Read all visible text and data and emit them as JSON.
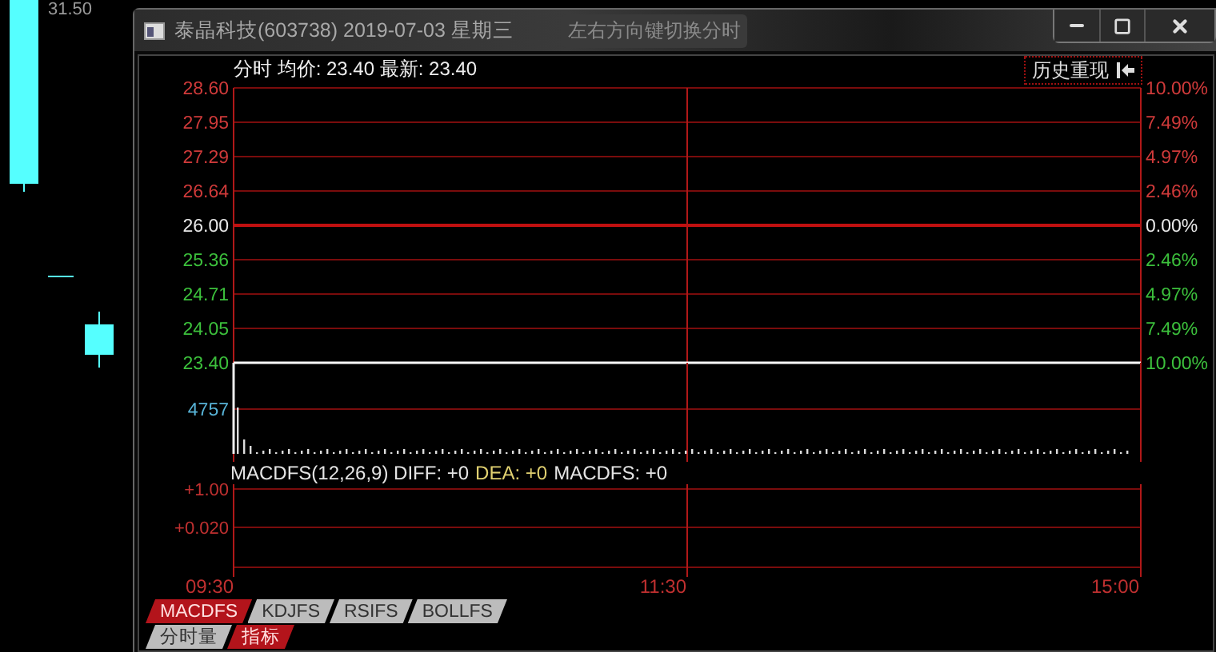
{
  "background_chart": {
    "price_label": "31.50"
  },
  "window": {
    "title": "泰晶科技(603738) 2019-07-03 星期三",
    "hint": "左右方向键切换分时"
  },
  "header": {
    "text": "分时 均价: 23.40 最新: 23.40",
    "history_button": "历史重现"
  },
  "price_panel": {
    "price_labels": [
      {
        "text": "28.60",
        "color": "#d03a3a"
      },
      {
        "text": "27.95",
        "color": "#d03a3a"
      },
      {
        "text": "27.29",
        "color": "#d03a3a"
      },
      {
        "text": "26.64",
        "color": "#d03a3a"
      },
      {
        "text": "26.00",
        "color": "#e8e8e8"
      },
      {
        "text": "25.36",
        "color": "#3cc03c"
      },
      {
        "text": "24.71",
        "color": "#3cc03c"
      },
      {
        "text": "24.05",
        "color": "#3cc03c"
      },
      {
        "text": "23.40",
        "color": "#3cc03c"
      }
    ],
    "percent_labels": [
      {
        "text": "10.00%",
        "color": "#d03a3a"
      },
      {
        "text": "7.49%",
        "color": "#d03a3a"
      },
      {
        "text": "4.97%",
        "color": "#d03a3a"
      },
      {
        "text": "2.46%",
        "color": "#d03a3a"
      },
      {
        "text": "0.00%",
        "color": "#e8e8e8"
      },
      {
        "text": "2.46%",
        "color": "#3cc03c"
      },
      {
        "text": "4.97%",
        "color": "#3cc03c"
      },
      {
        "text": "7.49%",
        "color": "#3cc03c"
      },
      {
        "text": "10.00%",
        "color": "#3cc03c"
      }
    ]
  },
  "volume_panel": {
    "label": "4757"
  },
  "macd_panel": {
    "legend": [
      {
        "text": "MACDFS(12,26,9) DIFF: +0",
        "color": "#e4e4e4"
      },
      {
        "text": "DEA: +0",
        "color": "#e0d070"
      },
      {
        "text": "MACDFS: +0",
        "color": "#e4e4e4"
      }
    ],
    "labels": [
      "+1.00",
      "+0.020"
    ]
  },
  "time_labels": [
    "09:30",
    "11:30",
    "15:00"
  ],
  "indicator_tabs": [
    {
      "label": "MACDFS",
      "selected": true
    },
    {
      "label": "KDJFS",
      "selected": false
    },
    {
      "label": "RSIFS",
      "selected": false
    },
    {
      "label": "BOLLFS",
      "selected": false
    }
  ],
  "view_tabs": [
    {
      "label": "分时量",
      "selected": false
    },
    {
      "label": "指标",
      "selected": true
    }
  ]
}
